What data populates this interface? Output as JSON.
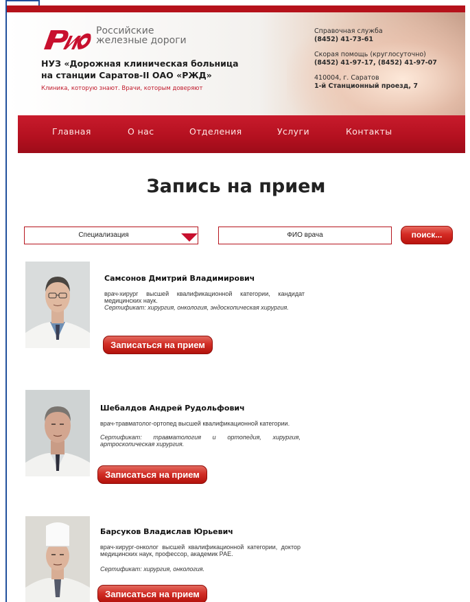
{
  "header": {
    "logo_text_line1": "Российские",
    "logo_text_line2": "железные дороги",
    "org_line1": "НУЗ «Дорожная клиническая больница",
    "org_line2": "на станции Саратов-II ОАО «РЖД»",
    "slogan": "Клиника, которую знают. Врачи, которым доверяют",
    "help_label": "Справочная служба",
    "help_phone": "(8452) 41-73-61",
    "emergency_label": "Скорая помощь (круглосуточно)",
    "emergency_phones": "(8452) 41-97-17, (8452) 41-97-07",
    "address_line1": "410004, г. Саратов",
    "address_line2": "1-й Станционный проезд, 7"
  },
  "nav": {
    "items": [
      "Главная",
      "О нас",
      "Отделения",
      "Услуги",
      "Контакты"
    ]
  },
  "page_title": "Запись на прием",
  "search": {
    "specialization_value": "Специализация",
    "name_placeholder": "ФИО врача",
    "search_label": "поиск..."
  },
  "doctors": [
    {
      "name": "Самсонов Дмитрий Владимирович",
      "description": "врач-хирург высшей квалификационной категории, кандидат медицинских наук.",
      "certificate": "Сертификат: хирургия, онкология, эндоскопическая хирургия.",
      "button_label": "Записаться на прием"
    },
    {
      "name": "Шебалдов Андрей Рудольфович",
      "description": "врач-травматолог-ортопед высшей квалификационной категории.",
      "certificate": "Сертификат: травматология и ортопедия, хирургия, артроскопическая хирургия.",
      "button_label": "Записаться на прием"
    },
    {
      "name": "Барсуков Владислав Юрьевич",
      "description": "врач-хирург-онколог высшей квалификационной категории, доктор медицинских наук, профессор, академик РАЕ.",
      "certificate": "Сертификат: хирургия, онкология.",
      "button_label": "Записаться на прием"
    }
  ],
  "colors": {
    "brand_red": "#b5121b",
    "nav_red": "#c81b2c",
    "button_red": "#d22e26"
  }
}
